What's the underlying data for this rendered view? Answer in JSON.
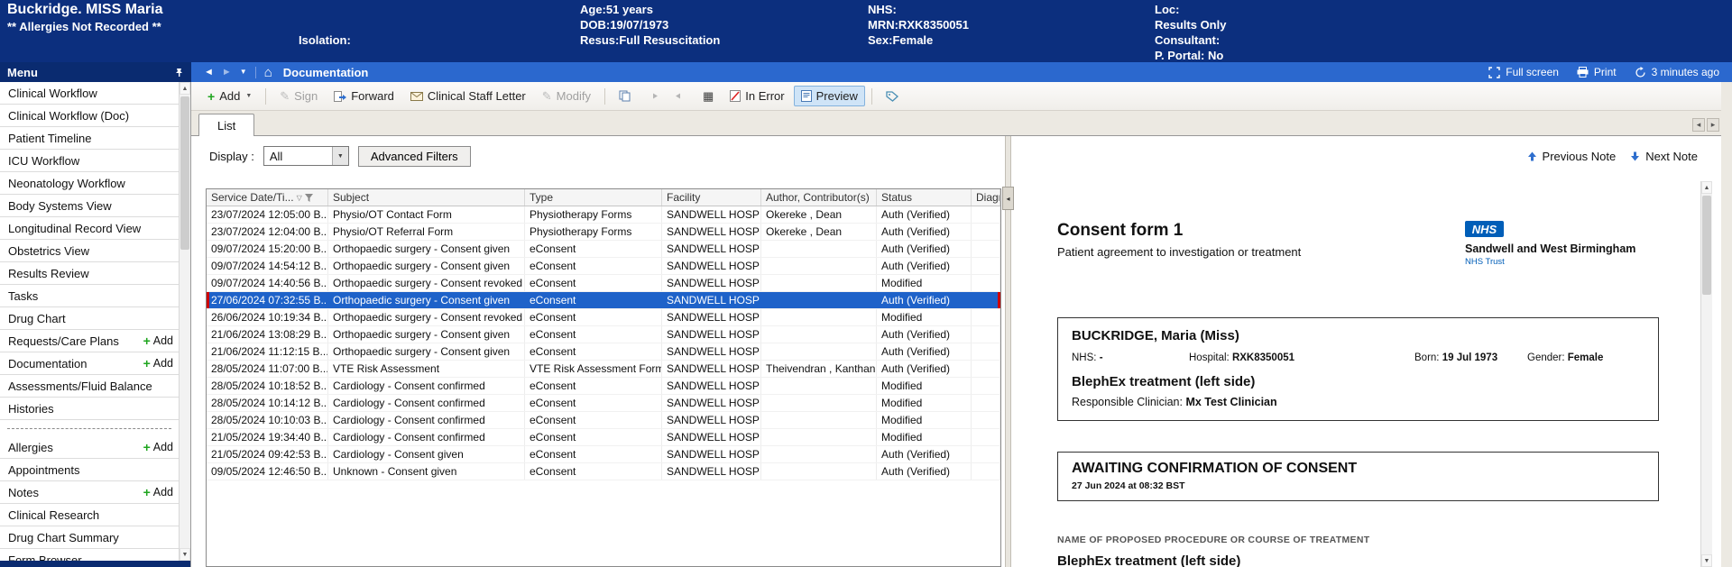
{
  "colors": {
    "banner_bg": "#0c2f7e",
    "navbar_bg": "#2b68ce",
    "menu_header_bg": "#0a2b70",
    "selected_row_bg": "#1e62c9",
    "selected_row_marker": "#cc0000",
    "nhs_blue": "#005eb8",
    "preview_button_bg": "#cfe4f7",
    "add_plus_green": "#1fa51f"
  },
  "banner": {
    "patient_name": "Buckridge. MISS Maria",
    "allergies": "** Allergies Not Recorded **",
    "isolation_label": "Isolation:",
    "age": "Age:51 years",
    "dob": "DOB:19/07/1973",
    "resus": "Resus:Full Resuscitation",
    "nhs": "NHS:",
    "mrn": "MRN:RXK8350051",
    "sex": "Sex:Female",
    "loc_label": "Loc:",
    "loc_value": "Results Only",
    "consultant_label": "Consultant:",
    "portal": "P. Portal: No"
  },
  "navbar": {
    "menu_label": "Menu",
    "page_title": "Documentation",
    "fullscreen_label": "Full screen",
    "print_label": "Print",
    "refresh_label": "3 minutes ago"
  },
  "sidebar": {
    "add_label": "Add",
    "items_top": [
      {
        "label": "Clinical Workflow"
      },
      {
        "label": "Clinical Workflow (Doc)"
      },
      {
        "label": "Patient Timeline"
      },
      {
        "label": "ICU Workflow"
      },
      {
        "label": "Neonatology Workflow"
      },
      {
        "label": "Body Systems View"
      },
      {
        "label": "Longitudinal Record View"
      },
      {
        "label": "Obstetrics View"
      },
      {
        "label": "Results Review"
      },
      {
        "label": "Tasks"
      },
      {
        "label": "Drug Chart"
      },
      {
        "label": "Requests/Care Plans",
        "add": true
      },
      {
        "label": "Documentation",
        "add": true
      },
      {
        "label": "Assessments/Fluid Balance"
      },
      {
        "label": "Histories"
      }
    ],
    "items_bottom": [
      {
        "label": "Allergies",
        "add": true
      },
      {
        "label": "Appointments"
      },
      {
        "label": "Notes",
        "add": true
      },
      {
        "label": "Clinical Research"
      },
      {
        "label": "Drug Chart Summary"
      },
      {
        "label": "Form Browser"
      }
    ]
  },
  "toolbar": {
    "add_label": "Add",
    "sign_label": "Sign",
    "forward_label": "Forward",
    "letter_label": "Clinical Staff Letter",
    "modify_label": "Modify",
    "in_error_label": "In Error",
    "preview_label": "Preview"
  },
  "tabs": {
    "list_label": "List"
  },
  "filters": {
    "display_label": "Display :",
    "display_value": "All",
    "advanced_label": "Advanced Filters"
  },
  "table": {
    "columns": [
      "Service Date/Ti...",
      "Subject",
      "Type",
      "Facility",
      "Author, Contributor(s)",
      "Status",
      "Diagnosis"
    ],
    "rows": [
      {
        "date": "23/07/2024 12:05:00 B...",
        "subject": "Physio/OT Contact Form",
        "type": "Physiotherapy Forms",
        "facility": "SANDWELL HOSP",
        "author": "Okereke , Dean",
        "status": "Auth (Verified)"
      },
      {
        "date": "23/07/2024 12:04:00 B...",
        "subject": "Physio/OT Referral Form",
        "type": "Physiotherapy Forms",
        "facility": "SANDWELL HOSP",
        "author": "Okereke , Dean",
        "status": "Auth (Verified)"
      },
      {
        "date": "09/07/2024 15:20:00 B...",
        "subject": "Orthopaedic surgery - Consent given",
        "type": "eConsent",
        "facility": "SANDWELL HOSP",
        "author": "",
        "status": "Auth (Verified)"
      },
      {
        "date": "09/07/2024 14:54:12 B...",
        "subject": "Orthopaedic surgery - Consent given",
        "type": "eConsent",
        "facility": "SANDWELL HOSP",
        "author": "",
        "status": "Auth (Verified)"
      },
      {
        "date": "09/07/2024 14:40:56 B...",
        "subject": "Orthopaedic surgery - Consent revoked",
        "type": "eConsent",
        "facility": "SANDWELL HOSP",
        "author": "",
        "status": "Modified"
      },
      {
        "date": "27/06/2024 07:32:55 B...",
        "subject": "Orthopaedic surgery - Consent given",
        "type": "eConsent",
        "facility": "SANDWELL HOSP",
        "author": "",
        "status": "Auth (Verified)",
        "selected": true
      },
      {
        "date": "26/06/2024 10:19:34 B...",
        "subject": "Orthopaedic surgery - Consent revoked",
        "type": "eConsent",
        "facility": "SANDWELL HOSP",
        "author": "",
        "status": "Modified"
      },
      {
        "date": "21/06/2024 13:08:29 B...",
        "subject": "Orthopaedic surgery - Consent given",
        "type": "eConsent",
        "facility": "SANDWELL HOSP",
        "author": "",
        "status": "Auth (Verified)"
      },
      {
        "date": "21/06/2024 11:12:15 B...",
        "subject": "Orthopaedic surgery - Consent given",
        "type": "eConsent",
        "facility": "SANDWELL HOSP",
        "author": "",
        "status": "Auth (Verified)"
      },
      {
        "date": "28/05/2024 11:07:00 B...",
        "subject": "VTE Risk Assessment",
        "type": "VTE Risk Assessment Forms",
        "facility": "SANDWELL HOSP",
        "author": "Theivendran , Kanthan",
        "status": "Auth (Verified)"
      },
      {
        "date": "28/05/2024 10:18:52 B...",
        "subject": "Cardiology - Consent confirmed",
        "type": "eConsent",
        "facility": "SANDWELL HOSP",
        "author": "",
        "status": "Modified"
      },
      {
        "date": "28/05/2024 10:14:12 B...",
        "subject": "Cardiology - Consent confirmed",
        "type": "eConsent",
        "facility": "SANDWELL HOSP",
        "author": "",
        "status": "Modified"
      },
      {
        "date": "28/05/2024 10:10:03 B...",
        "subject": "Cardiology - Consent confirmed",
        "type": "eConsent",
        "facility": "SANDWELL HOSP",
        "author": "",
        "status": "Modified"
      },
      {
        "date": "21/05/2024 19:34:40 B...",
        "subject": "Cardiology - Consent confirmed",
        "type": "eConsent",
        "facility": "SANDWELL HOSP",
        "author": "",
        "status": "Modified"
      },
      {
        "date": "21/05/2024 09:42:53 B...",
        "subject": "Cardiology - Consent given",
        "type": "eConsent",
        "facility": "SANDWELL HOSP",
        "author": "",
        "status": "Auth (Verified)"
      },
      {
        "date": "09/05/2024 12:46:50 B...",
        "subject": "Unknown - Consent given",
        "type": "eConsent",
        "facility": "SANDWELL HOSP",
        "author": "",
        "status": "Auth (Verified)"
      }
    ]
  },
  "preview": {
    "previous_label": "Previous Note",
    "next_label": "Next Note",
    "doc": {
      "title": "Consent form 1",
      "subtitle": "Patient agreement to investigation or treatment",
      "nhs_logo": "NHS",
      "trust_name": "Sandwell and West Birmingham",
      "trust_suffix": "NHS Trust",
      "patient_line": "BUCKRIDGE, Maria (Miss)",
      "nhs_label": "NHS:",
      "nhs_value": "-",
      "hospital_label": "Hospital:",
      "hospital_value": "RXK8350051",
      "born_label": "Born:",
      "born_value": "19 Jul 1973",
      "gender_label": "Gender:",
      "gender_value": "Female",
      "procedure": "BlephEx treatment (left side)",
      "clinician_label": "Responsible Clinician:",
      "clinician_value": "Mx Test Clinician",
      "status_title": "AWAITING CONFIRMATION OF CONSENT",
      "status_date": "27 Jun 2024 at 08:32 BST",
      "procedure_heading": "NAME OF PROPOSED PROCEDURE OR COURSE OF TREATMENT",
      "procedure_name": "BlephEx treatment (left side)"
    }
  }
}
